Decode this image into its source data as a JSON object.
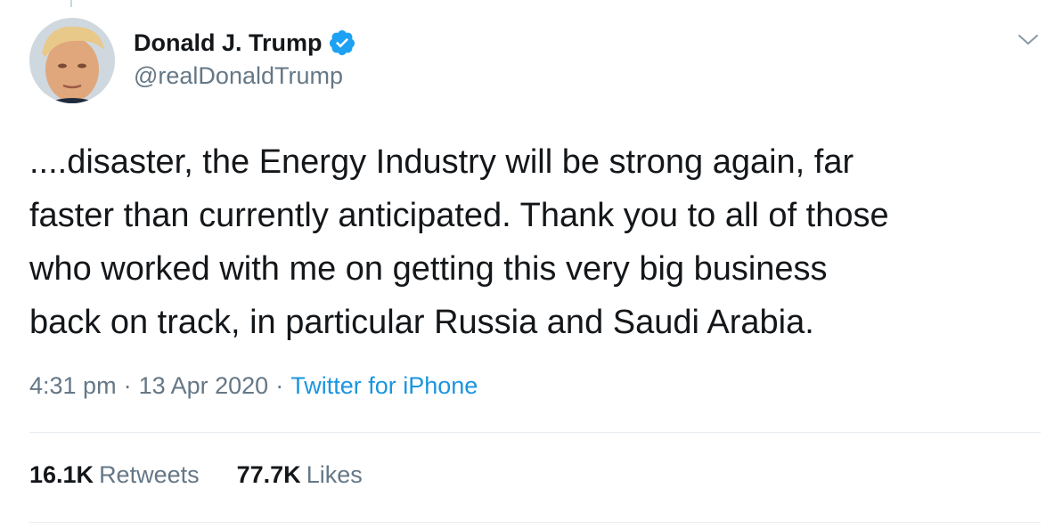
{
  "author": {
    "display_name": "Donald J. Trump",
    "handle": "@realDonaldTrump",
    "verified": true,
    "avatar_icon": "profile-photo"
  },
  "tweet": {
    "text": "....disaster, the Energy Industry will be strong again, far\nfaster than currently anticipated. Thank you to all of those\nwho worked with me on getting this very big business\nback on track, in particular Russia and Saudi Arabia.",
    "time": "4:31 pm",
    "date": "13 Apr 2020",
    "separator": "·",
    "source": "Twitter for iPhone"
  },
  "stats": {
    "retweets_count": "16.1K",
    "retweets_label": "Retweets",
    "likes_count": "77.7K",
    "likes_label": "Likes"
  },
  "colors": {
    "text": "#14171a",
    "secondary": "#657786",
    "link": "#1b95e0",
    "verified": "#1da1f2",
    "divider": "#e6ecf0"
  },
  "icons": {
    "verified": "verified-badge-icon",
    "caret": "chevron-down-icon"
  }
}
